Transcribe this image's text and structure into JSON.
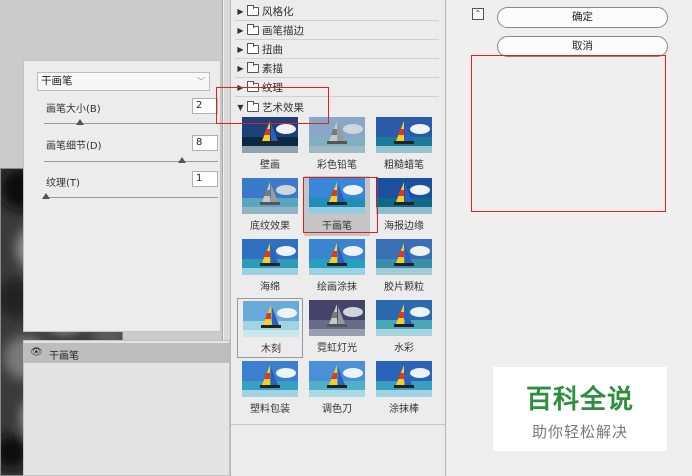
{
  "gallery": {
    "categories": [
      {
        "label": "风格化",
        "expanded": false
      },
      {
        "label": "画笔描边",
        "expanded": false
      },
      {
        "label": "扭曲",
        "expanded": false
      },
      {
        "label": "素描",
        "expanded": false
      },
      {
        "label": "纹理",
        "expanded": false
      },
      {
        "label": "艺术效果",
        "expanded": true
      }
    ],
    "filters": [
      {
        "label": "壁画"
      },
      {
        "label": "彩色铅笔"
      },
      {
        "label": "粗糙蜡笔"
      },
      {
        "label": "底纹效果"
      },
      {
        "label": "干画笔",
        "selected": true
      },
      {
        "label": "海报边缘"
      },
      {
        "label": "海绵"
      },
      {
        "label": "绘画涂抹"
      },
      {
        "label": "胶片颗粒"
      },
      {
        "label": "木刻"
      },
      {
        "label": "霓虹灯光"
      },
      {
        "label": "水彩"
      },
      {
        "label": "塑料包装"
      },
      {
        "label": "调色刀"
      },
      {
        "label": "涂抹棒"
      }
    ]
  },
  "settings": {
    "collapse_icon": "collapse-up-icon",
    "ok_label": "确定",
    "cancel_label": "取消",
    "selected_filter": "干画笔",
    "params": [
      {
        "label": "画笔大小(B)",
        "value": "2",
        "fraction": 0.2
      },
      {
        "label": "画笔细节(D)",
        "value": "8",
        "fraction": 0.8
      },
      {
        "label": "纹理(T)",
        "value": "1",
        "fraction": 0.0
      }
    ]
  },
  "layers": {
    "visibility_icon": "eye-icon",
    "active_layer": "干画笔"
  },
  "watermark": {
    "main": "百科全说",
    "sub": "助你轻松解决"
  },
  "colors": {
    "annotation": "#e02020",
    "watermark_green": "#2e8f3f"
  }
}
